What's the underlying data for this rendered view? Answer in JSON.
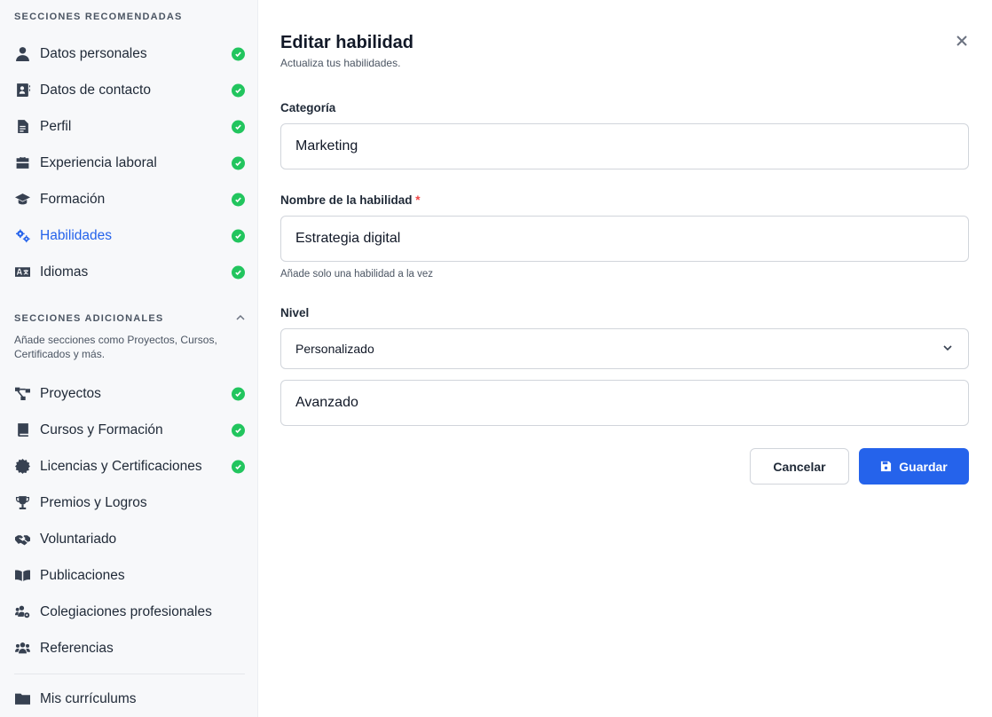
{
  "sidebar": {
    "recommended_title": "SECCIONES RECOMENDADAS",
    "recommended": [
      {
        "label": "Datos personales",
        "icon": "user-icon",
        "done": true
      },
      {
        "label": "Datos de contacto",
        "icon": "contact-card-icon",
        "done": true
      },
      {
        "label": "Perfil",
        "icon": "document-icon",
        "done": true
      },
      {
        "label": "Experiencia laboral",
        "icon": "briefcase-icon",
        "done": true
      },
      {
        "label": "Formación",
        "icon": "graduation-cap-icon",
        "done": true
      },
      {
        "label": "Habilidades",
        "icon": "gears-icon",
        "done": true,
        "active": true
      },
      {
        "label": "Idiomas",
        "icon": "language-icon",
        "done": true
      }
    ],
    "additional_title": "SECCIONES ADICIONALES",
    "additional_desc": "Añade secciones como Proyectos, Cursos, Certificados y más.",
    "additional": [
      {
        "label": "Proyectos",
        "icon": "project-diagram-icon",
        "done": true
      },
      {
        "label": "Cursos y Formación",
        "icon": "book-icon",
        "done": true
      },
      {
        "label": "Licencias y Certificaciones",
        "icon": "certificate-icon",
        "done": true
      },
      {
        "label": "Premios y Logros",
        "icon": "trophy-icon",
        "done": false
      },
      {
        "label": "Voluntariado",
        "icon": "handshake-icon",
        "done": false
      },
      {
        "label": "Publicaciones",
        "icon": "open-book-icon",
        "done": false
      },
      {
        "label": "Colegiaciones profesionales",
        "icon": "users-cog-icon",
        "done": false
      },
      {
        "label": "Referencias",
        "icon": "users-icon",
        "done": false
      }
    ],
    "resumes_label": "Mis currículums"
  },
  "modal": {
    "title": "Editar habilidad",
    "subtitle": "Actualiza tus habilidades.",
    "category_label": "Categoría",
    "category_value": "Marketing",
    "skill_label": "Nombre de la habilidad",
    "required_mark": "*",
    "skill_value": "Estrategia digital",
    "skill_hint": "Añade solo una habilidad a la vez",
    "level_label": "Nivel",
    "level_select": "Personalizado",
    "level_custom_value": "Avanzado",
    "cancel_label": "Cancelar",
    "save_label": "Guardar"
  },
  "colors": {
    "accent": "#2563eb",
    "success": "#22c55e",
    "required": "#ef4444"
  }
}
